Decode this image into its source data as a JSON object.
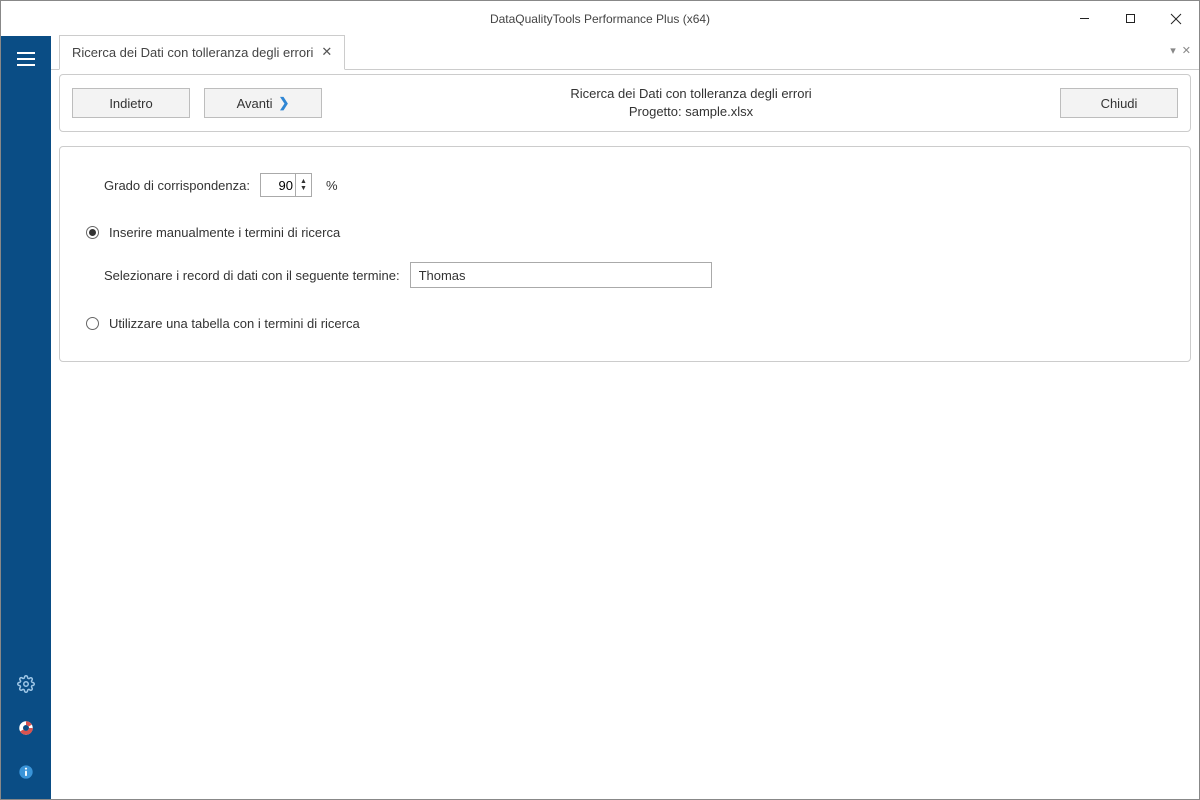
{
  "window": {
    "title": "DataQualityTools Performance Plus (x64)"
  },
  "tab": {
    "label": "Ricerca dei Dati con tolleranza degli errori"
  },
  "toolbar": {
    "back_label": "Indietro",
    "forward_label": "Avanti",
    "close_label": "Chiudi",
    "heading": "Ricerca dei Dati con tolleranza degli errori",
    "project_line": "Progetto: sample.xlsx"
  },
  "form": {
    "match_label": "Grado di corrispondenza:",
    "match_value": "90",
    "match_unit": "%",
    "radio_manual_label": "Inserire manualmente i termini di ricerca",
    "search_term_label": "Selezionare i record di dati con il seguente termine:",
    "search_term_value": "Thomas",
    "radio_table_label": "Utilizzare una tabella con i termini di ricerca"
  }
}
